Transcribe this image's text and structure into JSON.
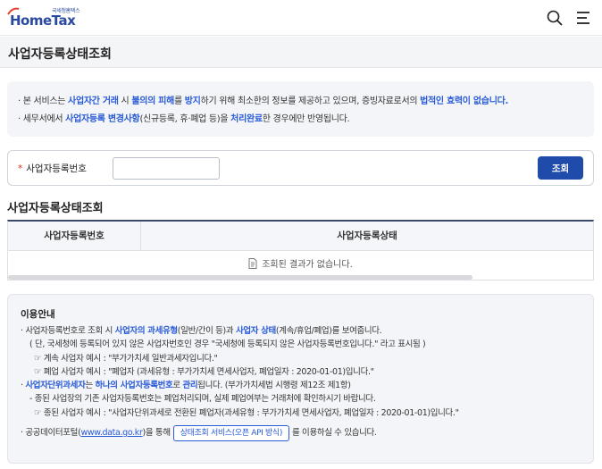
{
  "header": {
    "logo_small": "국세청홈택스",
    "logo_text": "HomeTax",
    "search_icon": "search-icon",
    "menu_icon": "hamburger-menu-icon"
  },
  "page_title": "사업자등록상태조회",
  "notice": {
    "line1": {
      "bullet": "·",
      "t1": "본 서비스는 ",
      "b1": "사업자간 거래",
      "t2": " 시 ",
      "b2": "불의의 피해",
      "t3": "를 ",
      "b3": "방지",
      "t4": "하기 위해 최소한의 정보를 제공하고 있으며, 증빙자료로서의 ",
      "b4": "법적인 효력이 없습니다."
    },
    "line2": {
      "bullet": "·",
      "t1": "세무서에서 ",
      "b1": "사업자등록 변경사항",
      "t2": "(신규등록, 휴·폐업 등)을 ",
      "b2": "처리완료",
      "t3": "한 경우에만 반영됩니다."
    }
  },
  "search": {
    "required_mark": "*",
    "label": "사업자등록번호",
    "input_value": "",
    "button": "조회"
  },
  "result": {
    "title": "사업자등록상태조회",
    "columns": [
      "사업자등록번호",
      "사업자등록상태"
    ],
    "empty_message": "조회된 결과가 없습니다."
  },
  "guide": {
    "title": "이용안내",
    "l1": {
      "bullet": "·",
      "t1": "사업자등록번호로 조회 시 ",
      "b1": "사업자의 과세유형",
      "t2": "(일반/간이 등)과 ",
      "b2": "사업자 상태",
      "t3": "(계속/휴업/폐업)를 보여줍니다."
    },
    "l2": "( 단, 국세청에 등록되어 있지 않은 사업자번호인 경우 \"국세청에 등록되지 않은 사업자등록번호입니다.\" 라고 표시됨 )",
    "l3": "☞ 계속 사업자 예시 : \"부가가치세 일반과세자입니다.\"",
    "l4": "☞ 폐업 사업자 예시 : \"폐업자 (과세유형 : 부가가치세 면세사업자, 폐업일자 : 2020-01-01)입니다.\"",
    "l5": {
      "bullet": "·",
      "b1": "사업자단위과세자",
      "t1": "는 ",
      "b2": "하나의 사업자등록번호",
      "t2": "로 ",
      "b3": "관리",
      "t3": "됩니다. (부가가치세법 시행령 제12조 제1항)"
    },
    "l6": "- 종된 사업장의 기존 사업자등록번호는 폐업처리되며, 실제 폐업여부는 거래처에 확인하시기 바랍니다.",
    "l7": "☞ 종된 사업자 예시 : \"사업자단위과세로 전환된 폐업자(과세유형 : 부가가치세 면세사업자, 폐업일자 : 2020-01-01)입니다.\"",
    "l8": {
      "bullet": "·",
      "t1": "공공데이터포털(",
      "link": "www.data.go.kr",
      "t2": ")을 통해",
      "button": "상태조회 서비스(오픈 API 방식)",
      "t3": "를 이용하실 수 있습니다."
    }
  },
  "colors": {
    "accent_blue": "#2a5bd7",
    "button_navy": "#1f4baa",
    "required_red": "#e0321e"
  }
}
